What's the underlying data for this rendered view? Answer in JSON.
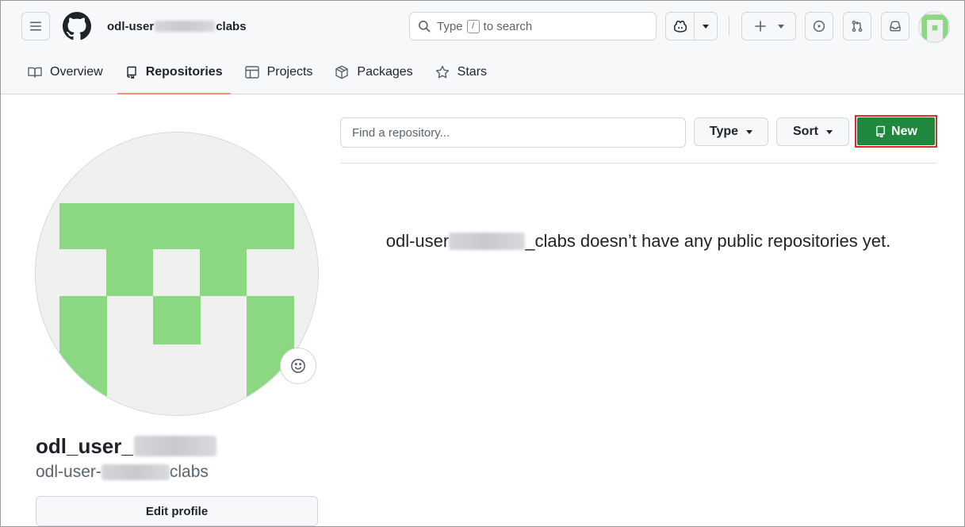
{
  "header": {
    "owner_prefix": "odl-user",
    "owner_suffix": "clabs",
    "search": {
      "before": "Type",
      "key": "/",
      "after": "to search"
    },
    "icons": {
      "menu": "hamburger-icon",
      "logo": "github-mark-icon",
      "search": "search-icon",
      "copilot": "copilot-icon",
      "create": "plus-icon",
      "issues": "issue-opened-icon",
      "pulls": "git-pull-request-icon",
      "inbox": "inbox-icon"
    }
  },
  "tabs": [
    {
      "label": "Overview",
      "icon": "book-icon"
    },
    {
      "label": "Repositories",
      "icon": "repo-icon",
      "active": true
    },
    {
      "label": "Projects",
      "icon": "table-icon"
    },
    {
      "label": "Packages",
      "icon": "package-icon"
    },
    {
      "label": "Stars",
      "icon": "star-icon"
    }
  ],
  "profile": {
    "name_prefix": "odl_user_",
    "login_prefix": "odl-user-",
    "login_suffix": "clabs",
    "edit_label": "Edit profile",
    "status_icon": "smiley-icon"
  },
  "repo_list": {
    "search_placeholder": "Find a repository...",
    "type_label": "Type",
    "sort_label": "Sort",
    "new_label": "New",
    "empty_prefix": "odl-user",
    "empty_suffix": "_clabs doesn’t have any public repositories yet."
  },
  "colors": {
    "accent_tab": "#fd8c73",
    "new_button": "#1f883d",
    "highlight": "#e0292b",
    "identicon": "#8cd882"
  }
}
